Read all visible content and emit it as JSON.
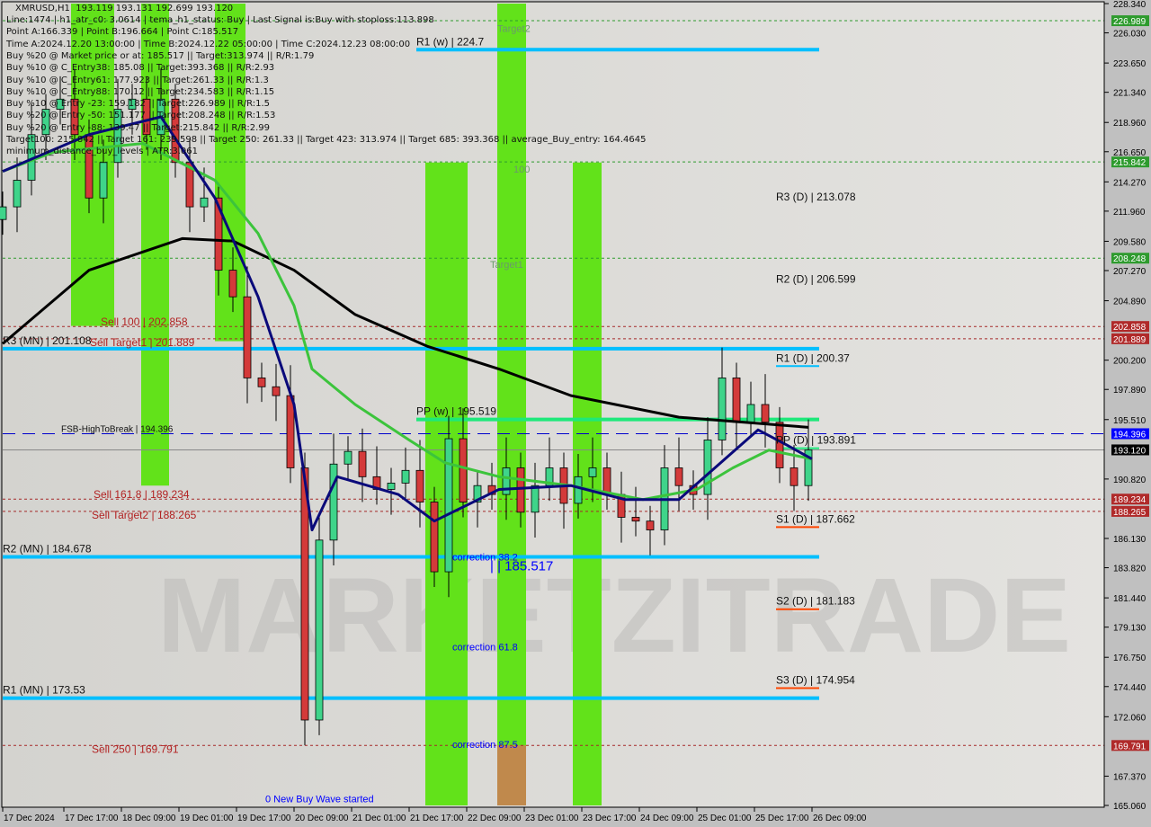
{
  "header": {
    "symbol": "XMRUSD,H1",
    "ohlc": "193.119 193.131 192.699 193.120",
    "info_lines": [
      "Line:1474 | h1_atr_c0: 3.0614 | tema_h1_status: Buy | Last Signal is:Buy with stoploss:113.898",
      "Point A:166.339 | Point B:196.664 | Point C:185.517",
      "Time A:2024.12.20 13:00:00 | Time B:2024.12.22 05:00:00 | Time C:2024.12.23 08:00:00",
      "Buy %20 @ Market price or at: 185.517 || Target:313.974 || R/R:1.79",
      "Buy %10 @ C_Entry38: 185.08 || Target:393.368 || R/R:2.93",
      "Buy %10 @ C_Entry61: 177.923 || Target:261.33 || R/R:1.3",
      "Buy %10 @ C_Entry88: 170.12 || Target:234.583 || R/R:1.15",
      "Buy %10 @ Entry -23: 159.182 || Target:226.989 || R/R:1.5",
      "Buy %20 @ Entry -50: 151.177 || Target:208.248 || R/R:1.53",
      "Buy %20 @ Entry -88: 139.47 || Target:215.842 || R/R:2.99",
      "Target100: 215.842 || Target 161: 239.598 || Target 250: 261.33 || Target 423: 313.974 || Target 685: 393.368 || average_Buy_entry: 164.4645",
      "minimum_distance_buy_levels | ATR:3.061"
    ]
  },
  "watermark": "MARKETZITRADE",
  "chart_data": {
    "type": "candlestick",
    "symbol": "XMRUSD",
    "timeframe": "H1",
    "ylim": [
      165.06,
      228.34
    ],
    "xlim": [
      "2024-12-17 00:00",
      "2024-12-26 12:00"
    ],
    "start": "2024-12-17 00:00",
    "interval_hours": 4,
    "close": [
      212.3,
      214.4,
      218,
      220,
      220.8,
      218,
      213,
      215.8,
      220,
      220.8,
      218,
      220.8,
      215.8,
      212.3,
      213,
      207.3,
      205.2,
      198.8,
      198.1,
      197.4,
      191.7,
      171.8,
      186,
      192,
      193,
      191,
      190,
      190.5,
      191.5,
      189,
      183.5,
      194,
      189,
      190.3,
      189.6,
      191.7,
      188.2,
      190.3,
      191.7,
      188.9,
      191,
      191.7,
      189.6,
      187.8,
      187.5,
      186.8,
      191.7,
      190.3,
      189.6,
      193.9,
      198.8,
      195.3,
      196.7,
      195.3,
      191.7,
      190.3,
      193.12
    ],
    "moving_averages": [
      {
        "color": "#000000",
        "points": [
          [
            "2024-12-17 00:00",
            201.5
          ],
          [
            "2024-12-18 00:00",
            207.3
          ],
          [
            "2024-12-19 02:00",
            209.8
          ],
          [
            "2024-12-19 16:00",
            209.6
          ],
          [
            "2024-12-20 09:00",
            207.3
          ],
          [
            "2024-12-21 02:00",
            203.8
          ],
          [
            "2024-12-21 22:00",
            201.3
          ],
          [
            "2024-12-22 18:00",
            199.5
          ],
          [
            "2024-12-23 14:00",
            197.4
          ],
          [
            "2024-12-24 20:00",
            195.7
          ],
          [
            "2024-12-26 08:00",
            194.9
          ]
        ]
      },
      {
        "color": "#3cc43c",
        "points": [
          [
            "2024-12-17 00:00",
            215.1
          ],
          [
            "2024-12-17 14:00",
            216.6
          ],
          [
            "2024-12-18 15:00",
            217.3
          ],
          [
            "2024-12-19 11:00",
            214.4
          ],
          [
            "2024-12-19 23:00",
            210.2
          ],
          [
            "2024-12-20 09:00",
            204.5
          ],
          [
            "2024-12-20 14:00",
            199.5
          ],
          [
            "2024-12-21 02:00",
            196.7
          ],
          [
            "2024-12-21 17:00",
            193.9
          ],
          [
            "2024-12-22 03:00",
            192.1
          ],
          [
            "2024-12-22 18:00",
            191
          ],
          [
            "2024-12-23 14:00",
            190.3
          ],
          [
            "2024-12-24 10:00",
            189.2
          ],
          [
            "2024-12-25 01:00",
            190
          ],
          [
            "2024-12-25 11:00",
            191.7
          ],
          [
            "2024-12-25 21:00",
            193.1
          ],
          [
            "2024-12-26 09:00",
            192.4
          ]
        ]
      },
      {
        "color": "#0a0a7a",
        "points": [
          [
            "2024-12-17 00:00",
            215.1
          ],
          [
            "2024-12-18 00:00",
            218
          ],
          [
            "2024-12-18 20:00",
            219.4
          ],
          [
            "2024-12-19 11:00",
            213
          ],
          [
            "2024-12-19 23:00",
            205.2
          ],
          [
            "2024-12-20 09:00",
            196.7
          ],
          [
            "2024-12-20 14:00",
            186.8
          ],
          [
            "2024-12-20 21:00",
            191
          ],
          [
            "2024-12-21 14:00",
            189.6
          ],
          [
            "2024-12-22 00:00",
            187.5
          ],
          [
            "2024-12-22 18:00",
            190
          ],
          [
            "2024-12-23 14:00",
            190.3
          ],
          [
            "2024-12-24 05:00",
            189.2
          ],
          [
            "2024-12-24 20:00",
            189.2
          ],
          [
            "2024-12-25 06:00",
            191.7
          ],
          [
            "2024-12-25 18:00",
            194.7
          ],
          [
            "2024-12-26 02:00",
            193.5
          ],
          [
            "2024-12-26 09:00",
            192.4
          ]
        ]
      }
    ],
    "y_ticks": [
      "228.340",
      "226.030",
      "223.650",
      "221.340",
      "218.960",
      "216.650",
      "214.270",
      "211.960",
      "209.580",
      "207.270",
      "204.890",
      "200.200",
      "197.890",
      "195.510",
      "190.820",
      "186.130",
      "183.820",
      "181.440",
      "179.130",
      "176.750",
      "174.440",
      "172.060",
      "167.370",
      "165.060"
    ],
    "x_ticks": [
      {
        "time": "2024-12-17 00:00",
        "label": "17 Dec 2024"
      },
      {
        "time": "2024-12-17 17:00",
        "label": "17 Dec 17:00"
      },
      {
        "time": "2024-12-18 09:00",
        "label": "18 Dec 09:00"
      },
      {
        "time": "2024-12-19 01:00",
        "label": "19 Dec 01:00"
      },
      {
        "time": "2024-12-19 17:00",
        "label": "19 Dec 17:00"
      },
      {
        "time": "2024-12-20 09:00",
        "label": "20 Dec 09:00"
      },
      {
        "time": "2024-12-21 01:00",
        "label": "21 Dec 01:00"
      },
      {
        "time": "2024-12-21 17:00",
        "label": "21 Dec 17:00"
      },
      {
        "time": "2024-12-22 09:00",
        "label": "22 Dec 09:00"
      },
      {
        "time": "2024-12-23 01:00",
        "label": "23 Dec 01:00"
      },
      {
        "time": "2024-12-23 17:00",
        "label": "23 Dec 17:00"
      },
      {
        "time": "2024-12-24 09:00",
        "label": "24 Dec 09:00"
      },
      {
        "time": "2024-12-25 01:00",
        "label": "25 Dec 01:00"
      },
      {
        "time": "2024-12-25 17:00",
        "label": "25 Dec 17:00"
      },
      {
        "time": "2024-12-26 09:00",
        "label": "26 Dec 09:00"
      }
    ],
    "price_tags": [
      {
        "value": "226.989",
        "color": "#2e9b2e"
      },
      {
        "value": "215.842",
        "color": "#2e9b2e"
      },
      {
        "value": "208.248",
        "color": "#2e9b2e"
      },
      {
        "value": "202.858",
        "color": "#b02a2a"
      },
      {
        "value": "201.889",
        "color": "#b02a2a"
      },
      {
        "value": "194.396",
        "color": "#0000ff"
      },
      {
        "value": "193.120",
        "color": "#000000"
      },
      {
        "value": "189.234",
        "color": "#b02a2a"
      },
      {
        "value": "188.265",
        "color": "#b02a2a"
      },
      {
        "value": "169.791",
        "color": "#b02a2a"
      }
    ],
    "bands": [
      {
        "from": "2024-12-17 19:00",
        "to": "2024-12-18 07:00",
        "top": 228.34,
        "bottom": 202.9,
        "color": "#62e21a"
      },
      {
        "from": "2024-12-18 14:30",
        "to": "2024-12-18 22:15",
        "top": 228.34,
        "bottom": 190.3,
        "color": "#62e21a"
      },
      {
        "from": "2024-12-19 11:00",
        "to": "2024-12-19 19:30",
        "top": 228.34,
        "bottom": 201.7,
        "color": "#62e21a"
      },
      {
        "from": "2024-12-21 21:30",
        "to": "2024-12-22 09:15",
        "top": 215.8,
        "bottom": 165.06,
        "color": "#62e21a"
      },
      {
        "from": "2024-12-22 17:30",
        "to": "2024-12-23 01:30",
        "top": 228.34,
        "bottom": 165.06,
        "color": "#62e21a"
      },
      {
        "from": "2024-12-23 14:30",
        "to": "2024-12-23 22:30",
        "top": 215.8,
        "bottom": 165.06,
        "color": "#62e21a"
      },
      {
        "from": "2024-12-22 17:30",
        "to": "2024-12-23 01:30",
        "top": 169.8,
        "bottom": 165.06,
        "color": "#c0894c"
      }
    ],
    "levels": [
      {
        "label": "R1 (w) | 224.7",
        "price": 224.7,
        "color": "#00bfff",
        "from": "2024-12-21 19:00",
        "to": "2024-12-26 11:00",
        "width": 4
      },
      {
        "label": "R3 (MN) | 201.108",
        "price": 201.108,
        "color": "#00bfff",
        "from": "2024-12-17 00:00",
        "to": "2024-12-26 11:00",
        "width": 4
      },
      {
        "label": "R2 (MN) | 184.678",
        "price": 184.678,
        "color": "#00bfff",
        "from": "2024-12-17 00:00",
        "to": "2024-12-26 11:00",
        "width": 4
      },
      {
        "label": "R1 (MN) | 173.53",
        "price": 173.53,
        "color": "#00bfff",
        "from": "2024-12-17 00:00",
        "to": "2024-12-26 11:00",
        "width": 4
      },
      {
        "label": "PP (w) | 195.519",
        "price": 195.519,
        "color": "#1ee87a",
        "from": "2024-12-21 19:00",
        "to": "2024-12-26 11:00",
        "width": 4
      },
      {
        "label": "R3 (D) | 213.078",
        "price": 213.078,
        "color": "#00bfff",
        "from": "2024-12-25 23:00",
        "to": "2024-12-26 11:00",
        "width": 0
      },
      {
        "label": "R2 (D) | 206.599",
        "price": 206.599,
        "color": "#00bfff",
        "from": "2024-12-25 23:00",
        "to": "2024-12-26 11:00",
        "width": 0
      },
      {
        "label": "R1 (D) | 200.37",
        "price": 200.37,
        "color": "#00bfff",
        "from": "2024-12-25 23:00",
        "to": "2024-12-26 11:00",
        "width": 2
      },
      {
        "label": "PP (D) | 193.891",
        "price": 193.891,
        "color": "#1ee87a",
        "from": "2024-12-25 23:00",
        "to": "2024-12-26 11:00",
        "width": 2
      },
      {
        "label": "S1 (D) | 187.662",
        "price": 187.662,
        "color": "#ff4500",
        "from": "2024-12-25 23:00",
        "to": "2024-12-26 11:00",
        "width": 2
      },
      {
        "label": "S2 (D) | 181.183",
        "price": 181.183,
        "color": "#ff4500",
        "from": "2024-12-25 23:00",
        "to": "2024-12-26 11:00",
        "width": 2
      },
      {
        "label": "S3 (D) | 174.954",
        "price": 174.954,
        "color": "#ff4500",
        "from": "2024-12-25 23:00",
        "to": "2024-12-26 11:00",
        "width": 2
      }
    ],
    "dotted_levels": [
      {
        "price": 226.989,
        "color": "#2e9b2e",
        "label": ""
      },
      {
        "price": 215.842,
        "color": "#2e9b2e",
        "label": ""
      },
      {
        "price": 208.248,
        "color": "#2e9b2e",
        "label": ""
      },
      {
        "price": 202.858,
        "color": "#a52a2a",
        "label": "Sell 100 | 202.858"
      },
      {
        "price": 201.889,
        "color": "#a52a2a",
        "label": "Sell Target1 | 201.889"
      },
      {
        "price": 189.234,
        "color": "#a52a2a",
        "label": "Sell 161.8 | 189.234"
      },
      {
        "price": 188.265,
        "color": "#a52a2a",
        "label": "Sell Target2 | 188.265"
      },
      {
        "price": 169.791,
        "color": "#a52a2a",
        "label": "Sell 250 | 169.791"
      }
    ],
    "fsb_line": {
      "price": 194.396,
      "label": "FSB-HighToBreak | 194.396",
      "color": "#0000cc"
    },
    "current_price": 193.12,
    "annotations": [
      {
        "text": "Target2",
        "price": 226.1,
        "time": "2024-12-22 17:30",
        "color": "#6a9a6a"
      },
      {
        "text": "100",
        "price": 215.0,
        "time": "2024-12-22 22:00",
        "color": "#6a9a6a"
      },
      {
        "text": "Target1",
        "price": 207.5,
        "time": "2024-12-22 15:30",
        "color": "#6a9a6a"
      },
      {
        "text": "correction 38.2",
        "price": 184.4,
        "time": "2024-12-22 05:00",
        "color": "#0000ff"
      },
      {
        "text": "| | 185.517",
        "price": 183.6,
        "time": "2024-12-22 15:30",
        "color": "#0000ff"
      },
      {
        "text": "correction 61.8",
        "price": 177.3,
        "time": "2024-12-22 05:00",
        "color": "#0000ff"
      },
      {
        "text": "correction 87.5",
        "price": 169.6,
        "time": "2024-12-22 05:00",
        "color": "#0000ff"
      },
      {
        "text": "0 New Buy Wave started",
        "price": 165.3,
        "time": "2024-12-20 01:00",
        "color": "#0000ff"
      }
    ]
  }
}
